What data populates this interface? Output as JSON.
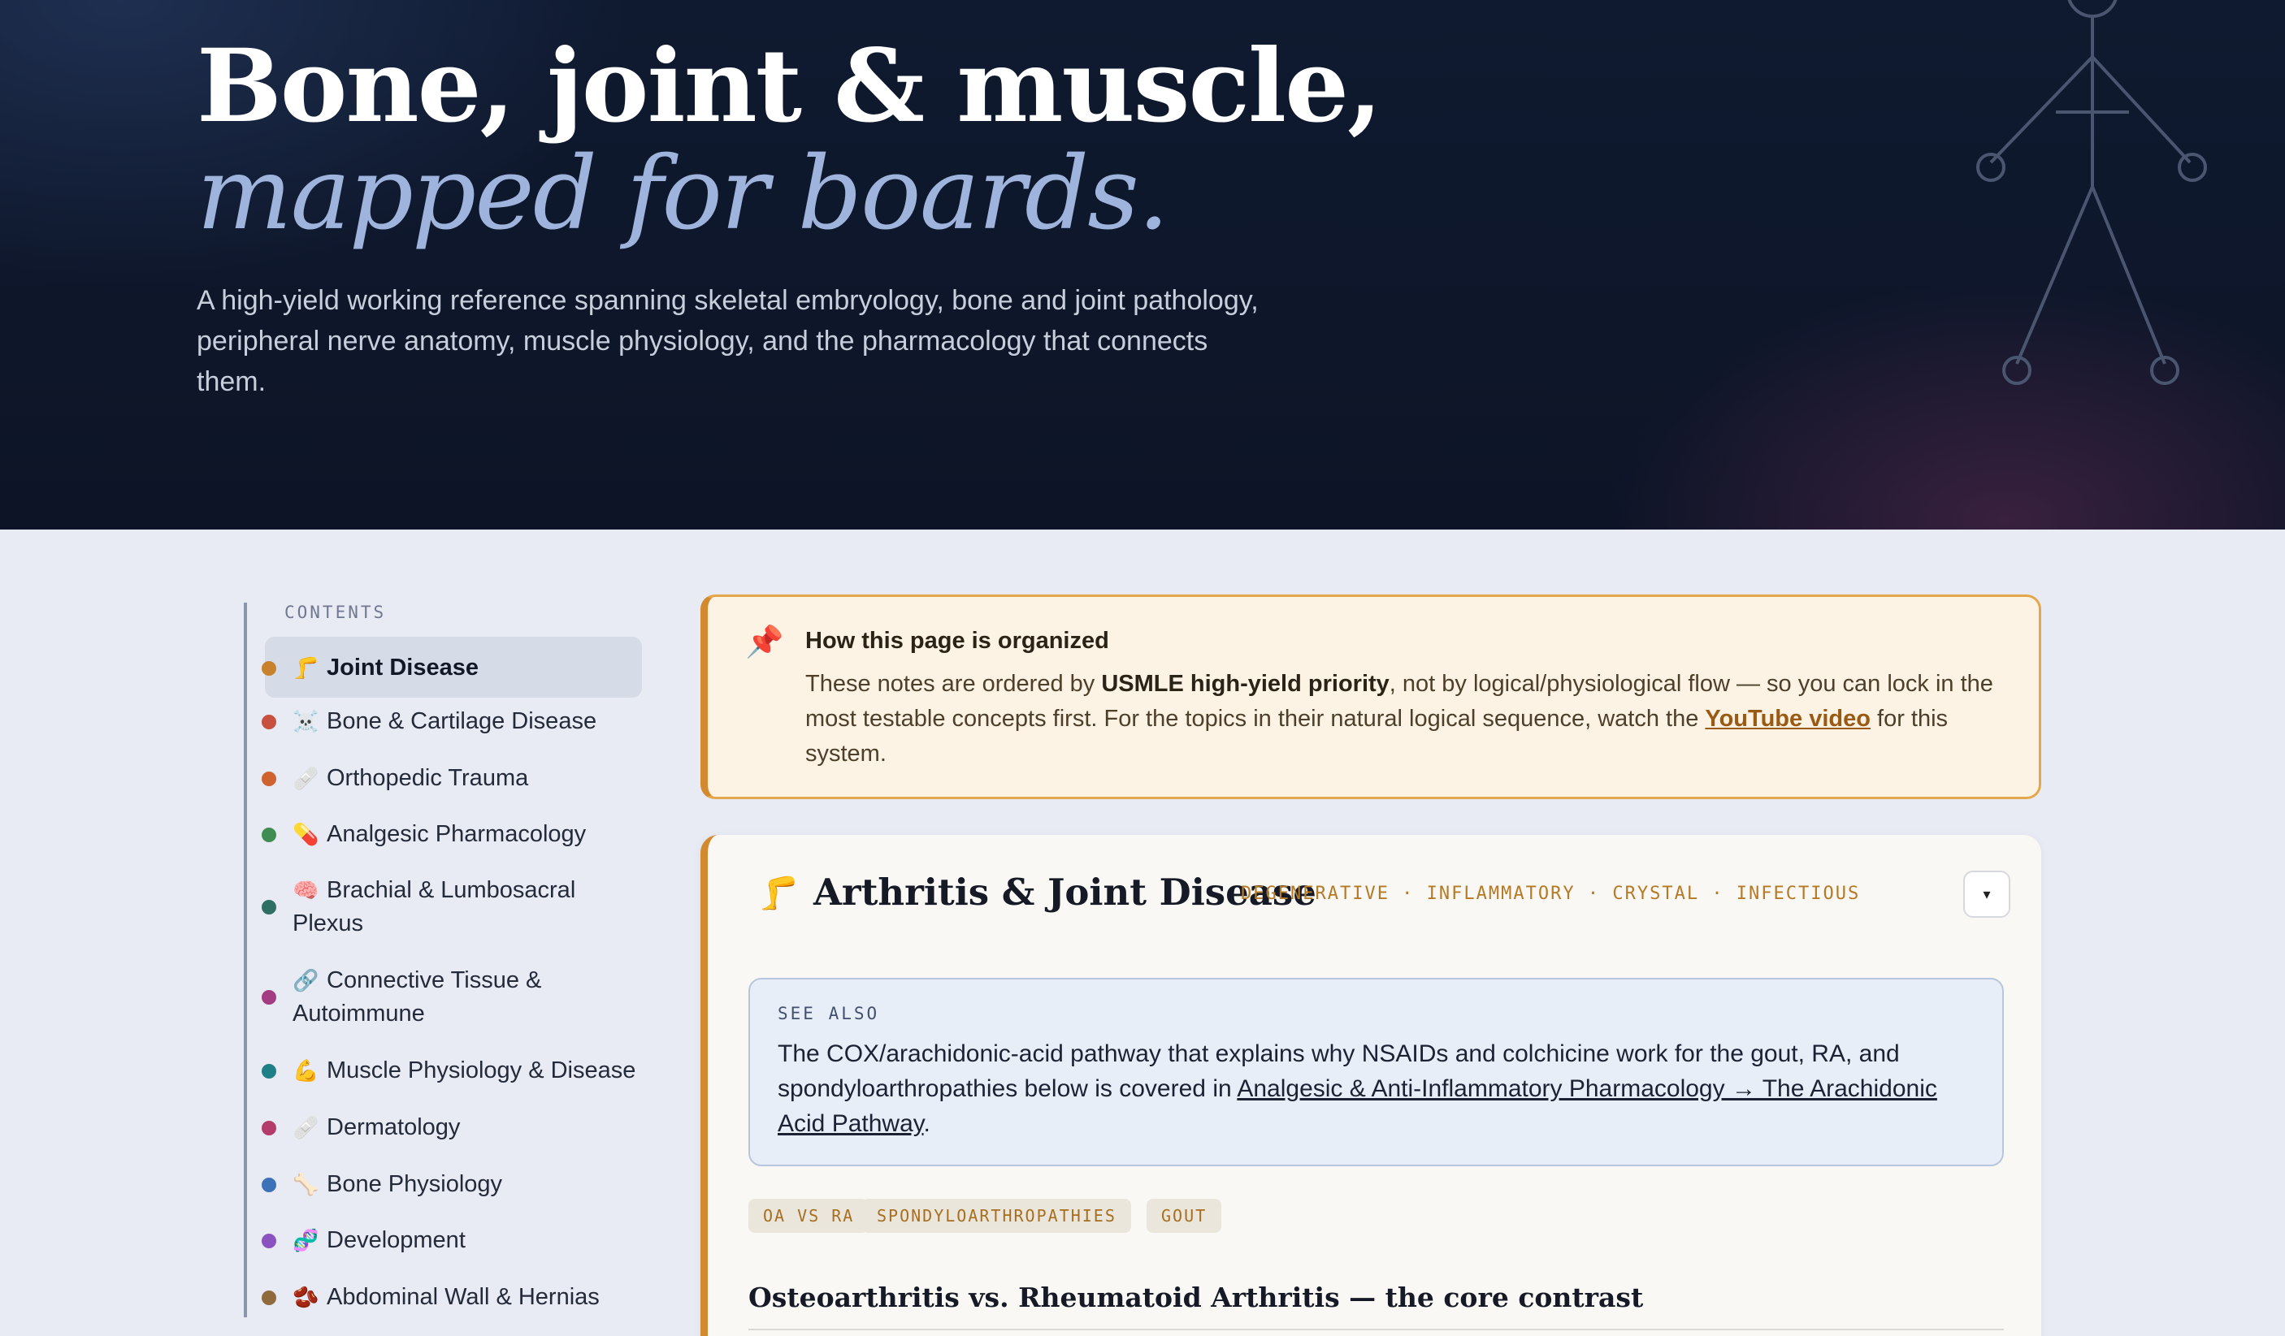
{
  "hero": {
    "title_line1": "Bone, joint & muscle,",
    "title_line2": "mapped for boards.",
    "lead": "A high-yield working reference spanning skeletal embryology, bone and joint pathology, peripheral nerve anatomy, muscle physiology, and the pharmacology that connects them.",
    "figure_icon": "stick-figure-skeleton-icon"
  },
  "sidebar": {
    "label": "CONTENTS",
    "items": [
      {
        "emoji": "🦵",
        "label": "Joint Disease",
        "dot_color": "#c9822c",
        "active": true
      },
      {
        "emoji": "☠️",
        "label": "Bone & Cartilage Disease",
        "dot_color": "#c8503f"
      },
      {
        "emoji": "🩹",
        "label": "Orthopedic Trauma",
        "dot_color": "#d0622f"
      },
      {
        "emoji": "💊",
        "label": "Analgesic Pharmacology",
        "dot_color": "#3f8d52"
      },
      {
        "emoji": "🧠",
        "label": "Brachial & Lumbosacral Plexus",
        "dot_color": "#2f6e63"
      },
      {
        "emoji": "🔗",
        "label": "Connective Tissue & Autoimmune",
        "dot_color": "#a33c83"
      },
      {
        "emoji": "💪",
        "label": "Muscle Physiology & Disease",
        "dot_color": "#1e7f86"
      },
      {
        "emoji": "🩹",
        "label": "Dermatology",
        "dot_color": "#b33c6a"
      },
      {
        "emoji": "🦴",
        "label": "Bone Physiology",
        "dot_color": "#3d72b8"
      },
      {
        "emoji": "🧬",
        "label": "Development",
        "dot_color": "#8a53c0"
      },
      {
        "emoji": "🫘",
        "label": "Abdominal Wall & Hernias",
        "dot_color": "#8e6a3c"
      }
    ]
  },
  "callout": {
    "icon": "pushpin-icon",
    "title": "How this page is organized",
    "body_pre": "These notes are ordered by ",
    "body_bold": "USMLE high-yield priority",
    "body_mid": ", not by logical/physiological flow — so you can lock in the most testable concepts first. For the topics in their natural logical sequence, watch the ",
    "link": "YouTube video",
    "body_post": " for this system."
  },
  "section": {
    "emoji": "🦵",
    "title": "Arthritis & Joint Disease",
    "tags": "DEGENERATIVE · INFLAMMATORY · CRYSTAL · INFECTIOUS",
    "collapse_symbol": "▾",
    "see_also": {
      "label": "SEE ALSO",
      "text_pre": "The COX/arachidonic-acid pathway that explains why NSAIDs and colchicine work for the gout, RA, and spondyloarthropathies below is covered in ",
      "link": "Analgesic & Anti-Inflammatory Pharmacology → The Arachidonic Acid Pathway",
      "text_post": "."
    },
    "chips": [
      "OA VS RA",
      "SPONDYLOARTHROPATHIES",
      "GOUT"
    ],
    "subheading": "Osteoarthritis vs. Rheumatoid Arthritis — the core contrast"
  }
}
